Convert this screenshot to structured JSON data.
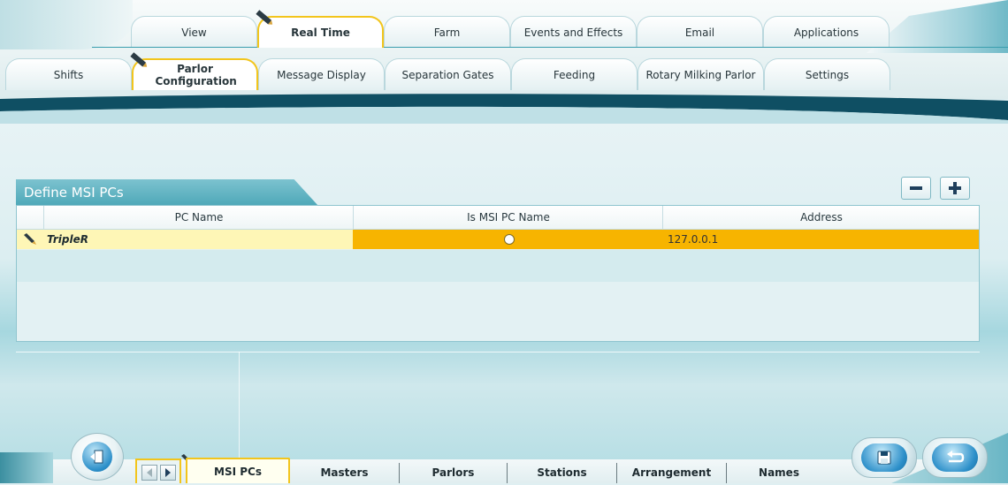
{
  "top_tabs": [
    {
      "label": "View"
    },
    {
      "label": "Real Time",
      "active": true
    },
    {
      "label": "Farm"
    },
    {
      "label": "Events and Effects"
    },
    {
      "label": "Email"
    },
    {
      "label": "Applications"
    }
  ],
  "sub_tabs": [
    {
      "label": "Shifts"
    },
    {
      "label": "Parlor Configuration",
      "active": true
    },
    {
      "label": "Message Display"
    },
    {
      "label": "Separation Gates"
    },
    {
      "label": "Feeding"
    },
    {
      "label": "Rotary Milking Parlor"
    },
    {
      "label": "Settings"
    }
  ],
  "section": {
    "title": "Define MSI PCs",
    "remove_icon": "minus-icon",
    "add_icon": "plus-icon"
  },
  "grid": {
    "columns": [
      "PC Name",
      "Is MSI PC Name",
      "Address"
    ],
    "rows": [
      {
        "pc_name": "TripleR",
        "is_msi_pc_name": false,
        "address": "127.0.0.1",
        "editing": true
      }
    ]
  },
  "bottom_tabs": [
    {
      "label": "MSI PCs",
      "active": true
    },
    {
      "label": "Masters"
    },
    {
      "label": "Parlors"
    },
    {
      "label": "Stations"
    },
    {
      "label": "Arrangement"
    },
    {
      "label": "Names"
    }
  ],
  "icons": {
    "exit": "exit-door-icon",
    "save": "save-disk-icon",
    "back": "return-arrow-icon",
    "prev": "arrow-left-icon",
    "next": "arrow-right-icon",
    "edit": "pencil-icon"
  },
  "colors": {
    "accent_yellow": "#f2c51c",
    "row_highlight": "#f7b400",
    "name_cell": "#fef6b6",
    "section_teal": "#4ea8b8",
    "dark_band": "#0f4f63"
  }
}
